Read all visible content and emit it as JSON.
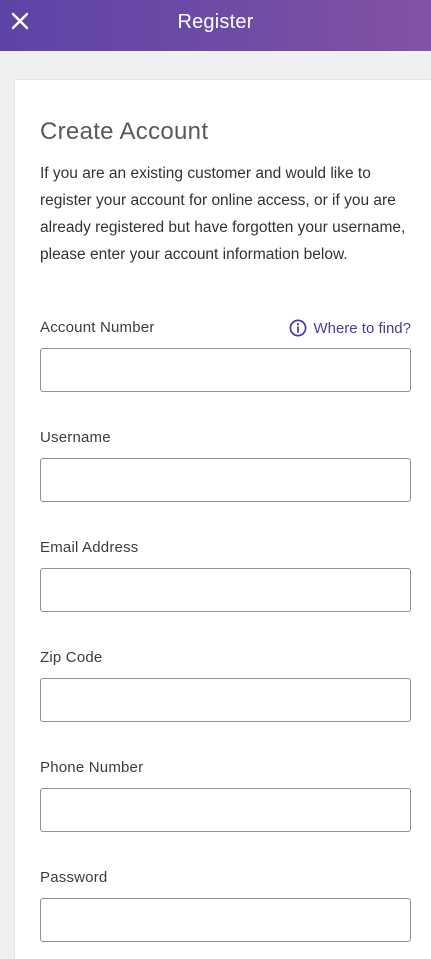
{
  "header": {
    "title": "Register",
    "close_icon": "close-icon"
  },
  "card": {
    "title": "Create Account",
    "description": "If you are an existing customer and would like to register your account for online access, or if you are already registered but have forgotten your username, please enter your account information below.",
    "help_link": {
      "label": "Where to find?",
      "icon": "info-icon"
    },
    "fields": {
      "account_number": {
        "label": "Account Number",
        "value": ""
      },
      "username": {
        "label": "Username",
        "value": ""
      },
      "email": {
        "label": "Email Address",
        "value": ""
      },
      "zip": {
        "label": "Zip Code",
        "value": ""
      },
      "phone": {
        "label": "Phone Number",
        "value": ""
      },
      "password": {
        "label": "Password",
        "value": ""
      }
    }
  },
  "colors": {
    "header_start": "#5e43a6",
    "header_end": "#8452a4",
    "link": "#4b3a9e",
    "page_background": "#eef0f1"
  }
}
